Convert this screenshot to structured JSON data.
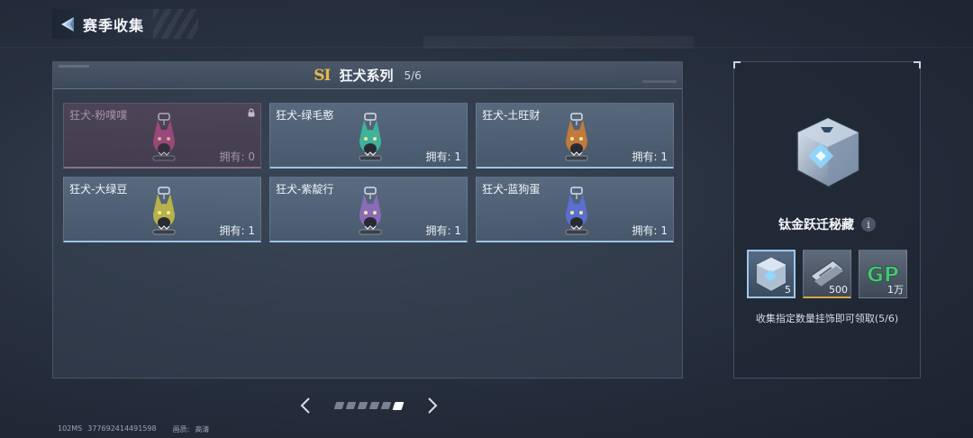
{
  "header": {
    "title": "赛季收集"
  },
  "series": {
    "badge": "SI",
    "title": "狂犬系列",
    "count": "5/6"
  },
  "cards": [
    {
      "name": "狂犬-粉噗噗",
      "owned_label": "拥有: 0",
      "locked": true,
      "color": "#c04a8e"
    },
    {
      "name": "狂犬-绿毛憨",
      "owned_label": "拥有: 1",
      "locked": false,
      "color": "#3fb39a"
    },
    {
      "name": "狂犬-土旺财",
      "owned_label": "拥有: 1",
      "locked": false,
      "color": "#c07a3a"
    },
    {
      "name": "狂犬-大绿豆",
      "owned_label": "拥有: 1",
      "locked": false,
      "color": "#b7b24a"
    },
    {
      "name": "狂犬-紫靛行",
      "owned_label": "拥有: 1",
      "locked": false,
      "color": "#8a6bb8"
    },
    {
      "name": "狂犬-蓝狗蛋",
      "owned_label": "拥有: 1",
      "locked": false,
      "color": "#5a6fd0"
    }
  ],
  "pager": {
    "total_pages": 6,
    "current_page": 6
  },
  "reward": {
    "title": "钛金跃迁秘藏",
    "info_label": "i",
    "items": [
      {
        "icon": "crate-icon",
        "qty": "5",
        "selected": true
      },
      {
        "icon": "card-voucher-icon",
        "qty": "500",
        "selected": false
      },
      {
        "icon": "gp-coin-icon",
        "qty": "1万",
        "selected": false,
        "text": "GP"
      }
    ],
    "description": "收集指定数量挂饰即可领取(5/6)"
  },
  "footer": {
    "ping": "102MS",
    "uid": "377692414491598",
    "quality_label": "画质:",
    "quality_value": "高清"
  },
  "colors": {
    "accent_blue": "#9cc2e6",
    "gold": "#e6b84a",
    "gp_green": "#4fbf7a"
  }
}
